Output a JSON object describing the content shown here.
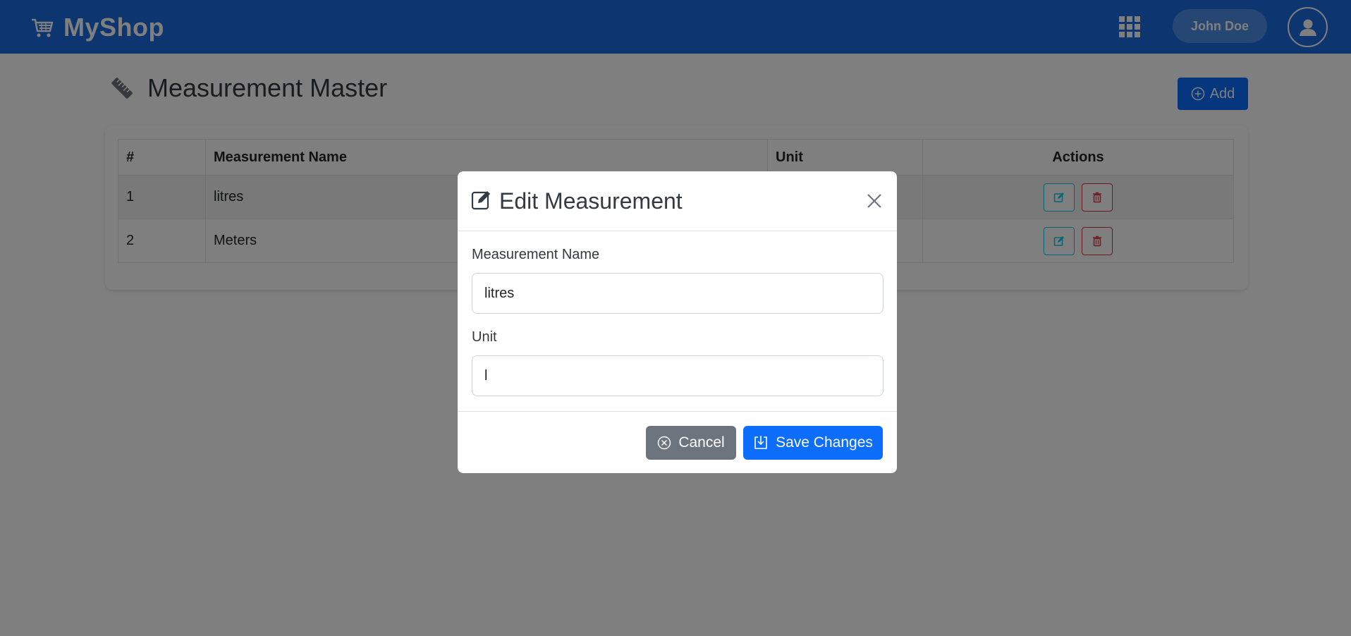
{
  "header": {
    "brand": "MyShop",
    "user_name": "John Doe",
    "brand_icon": "cart-icon",
    "apps_icon": "apps-grid-icon",
    "avatar_icon": "user-avatar-icon"
  },
  "page": {
    "title": "Measurement Master",
    "title_icon": "ruler-icon",
    "add_label": "Add"
  },
  "table": {
    "headers": [
      "#",
      "Measurement Name",
      "Unit",
      "Actions"
    ],
    "rows": [
      {
        "num": "1",
        "name": "litres",
        "unit": ""
      },
      {
        "num": "2",
        "name": "Meters",
        "unit": ""
      }
    ]
  },
  "modal": {
    "title": "Edit Measurement",
    "name_label": "Measurement Name",
    "name_value": "litres",
    "unit_label": "Unit",
    "unit_value": "l",
    "cancel_label": "Cancel",
    "save_label": "Save Changes"
  },
  "colors": {
    "navbar": "#1a6ce0",
    "primary": "#0d6efd",
    "secondary": "#6c757d",
    "info": "#0dcaf0",
    "danger": "#dc3545"
  }
}
